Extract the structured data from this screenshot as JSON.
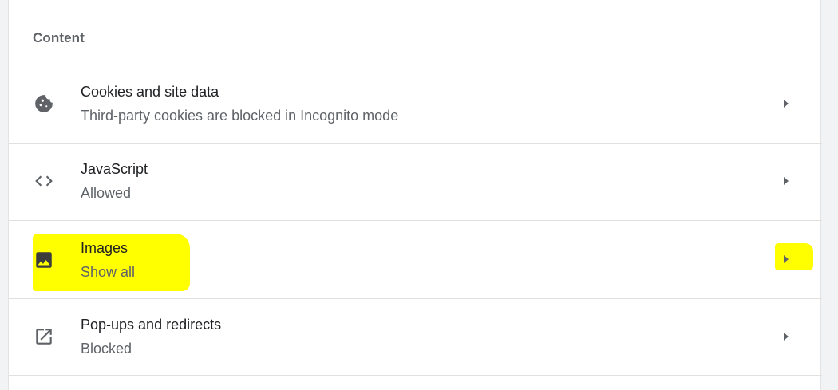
{
  "section": {
    "title": "Content"
  },
  "rows": [
    {
      "icon": "cookie-icon",
      "title": "Cookies and site data",
      "subtitle": "Third-party cookies are blocked in Incognito mode"
    },
    {
      "icon": "code-icon",
      "title": "JavaScript",
      "subtitle": "Allowed"
    },
    {
      "icon": "image-icon",
      "title": "Images",
      "subtitle": "Show all"
    },
    {
      "icon": "open-in-new-icon",
      "title": "Pop-ups and redirects",
      "subtitle": "Blocked"
    }
  ],
  "colors": {
    "highlight": "#ffff00",
    "icon": "#5f6368",
    "title_text": "#202124",
    "subtitle_text": "#5f6368"
  }
}
